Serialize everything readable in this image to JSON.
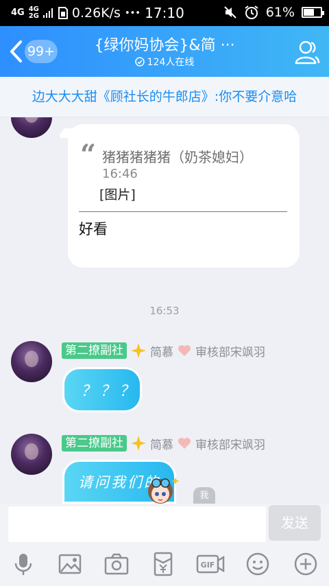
{
  "status": {
    "net1": "4G",
    "net2": "4G",
    "net3": "2G",
    "speed": "0.26K/s",
    "dots": "•••",
    "time": "17:10",
    "battery": "61%",
    "battery_level": 0.61
  },
  "header": {
    "unread": "99+",
    "title": "{绿你妈协会}&简 ···",
    "online": "124人在线"
  },
  "notice": "边大大大甜《顾社长的牛郎店》:你不要介意哈",
  "quote": {
    "name": "猪猪猪猪猪（奶茶媳妇）",
    "time": "16:46",
    "content": "[图片]",
    "reply": "好看"
  },
  "timestamp": "16:53",
  "messages": [
    {
      "badge": "第二撩副社",
      "name": "简慕",
      "extra": "审核部宋飒羽",
      "text": "？？？"
    },
    {
      "badge": "第二撩副社",
      "name": "简慕",
      "extra": "审核部宋飒羽",
      "text": "请问我们的"
    }
  ],
  "input": {
    "placeholder": "",
    "send": "发送",
    "self_tag": "我"
  },
  "toolbar": [
    "microphone-icon",
    "image-icon",
    "camera-icon",
    "red-packet-icon",
    "gif-icon",
    "emoji-icon",
    "plus-icon"
  ],
  "colors": {
    "header_start": "#2e8fff",
    "header_end": "#40b7f5",
    "notice_text": "#1a8cf0",
    "badge_green": "#49c98a",
    "bubble": "#3cc4f2"
  }
}
